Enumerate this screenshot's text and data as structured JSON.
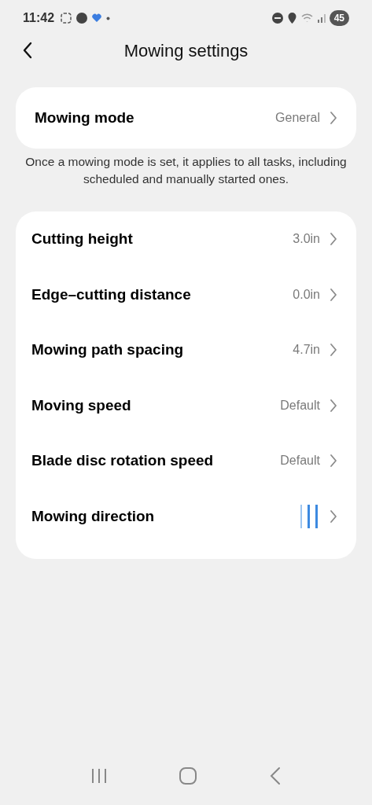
{
  "status_bar": {
    "time": "11:42",
    "battery": "45"
  },
  "header": {
    "title": "Mowing settings"
  },
  "mode": {
    "label": "Mowing mode",
    "value": "General"
  },
  "note": "Once a mowing mode is set, it applies to all tasks, including scheduled and manually started ones.",
  "settings": [
    {
      "kind": "value",
      "label": "Cutting height",
      "value": "3.0in"
    },
    {
      "kind": "value",
      "label": "Edge–cutting distance",
      "value": "0.0in"
    },
    {
      "kind": "value",
      "label": "Mowing path spacing",
      "value": "4.7in"
    },
    {
      "kind": "value",
      "label": "Moving speed",
      "value": "Default"
    },
    {
      "kind": "value",
      "label": "Blade disc rotation speed",
      "value": "Default"
    },
    {
      "kind": "direction",
      "label": "Mowing direction"
    }
  ]
}
